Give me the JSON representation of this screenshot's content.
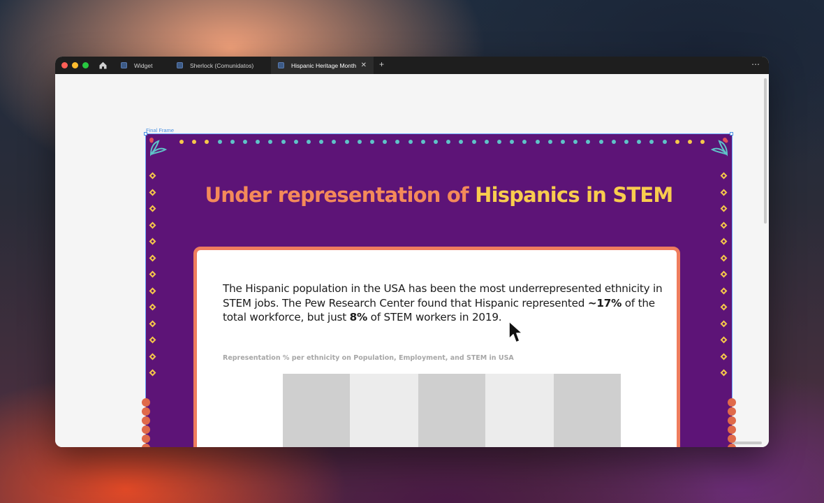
{
  "browser": {
    "tabs": [
      {
        "label": "Widget",
        "active": false
      },
      {
        "label": "Sherlock (Comunidatos)",
        "active": false
      },
      {
        "label": "Hispanic Heritage Month",
        "active": true
      }
    ],
    "new_tab_label": "+",
    "menu_label": "⋯",
    "close_glyph": "✕",
    "icons": [
      "home-icon",
      "figma-file-icon",
      "close-icon",
      "more-icon"
    ]
  },
  "canvas": {
    "frame_label": "Final Frame"
  },
  "design": {
    "heading_part1": "Under representation of ",
    "heading_part2": "Hispanics in STEM",
    "para_1": "The Hispanic population in the USA has been the most underrepresented ethnicity in STEM jobs. The Pew Research Center found that Hispanic represented ",
    "para_bold_1": "~17%",
    "para_2": " of the total workforce, but just ",
    "para_bold_2": "8%",
    "para_3": " of STEM workers in 2019.",
    "chart_title": "Representation % per ethnicity on Population, Employment, and STEM in USA"
  },
  "colors": {
    "frame_bg": "#5d1477",
    "heading_orange": "#f48a5a",
    "heading_yellow": "#f9cc4e",
    "card_border": "#ef7d5e",
    "dot_teal": "#5fc3c8",
    "dot_yellow": "#f6c84a",
    "dot_red": "#e0505a"
  }
}
